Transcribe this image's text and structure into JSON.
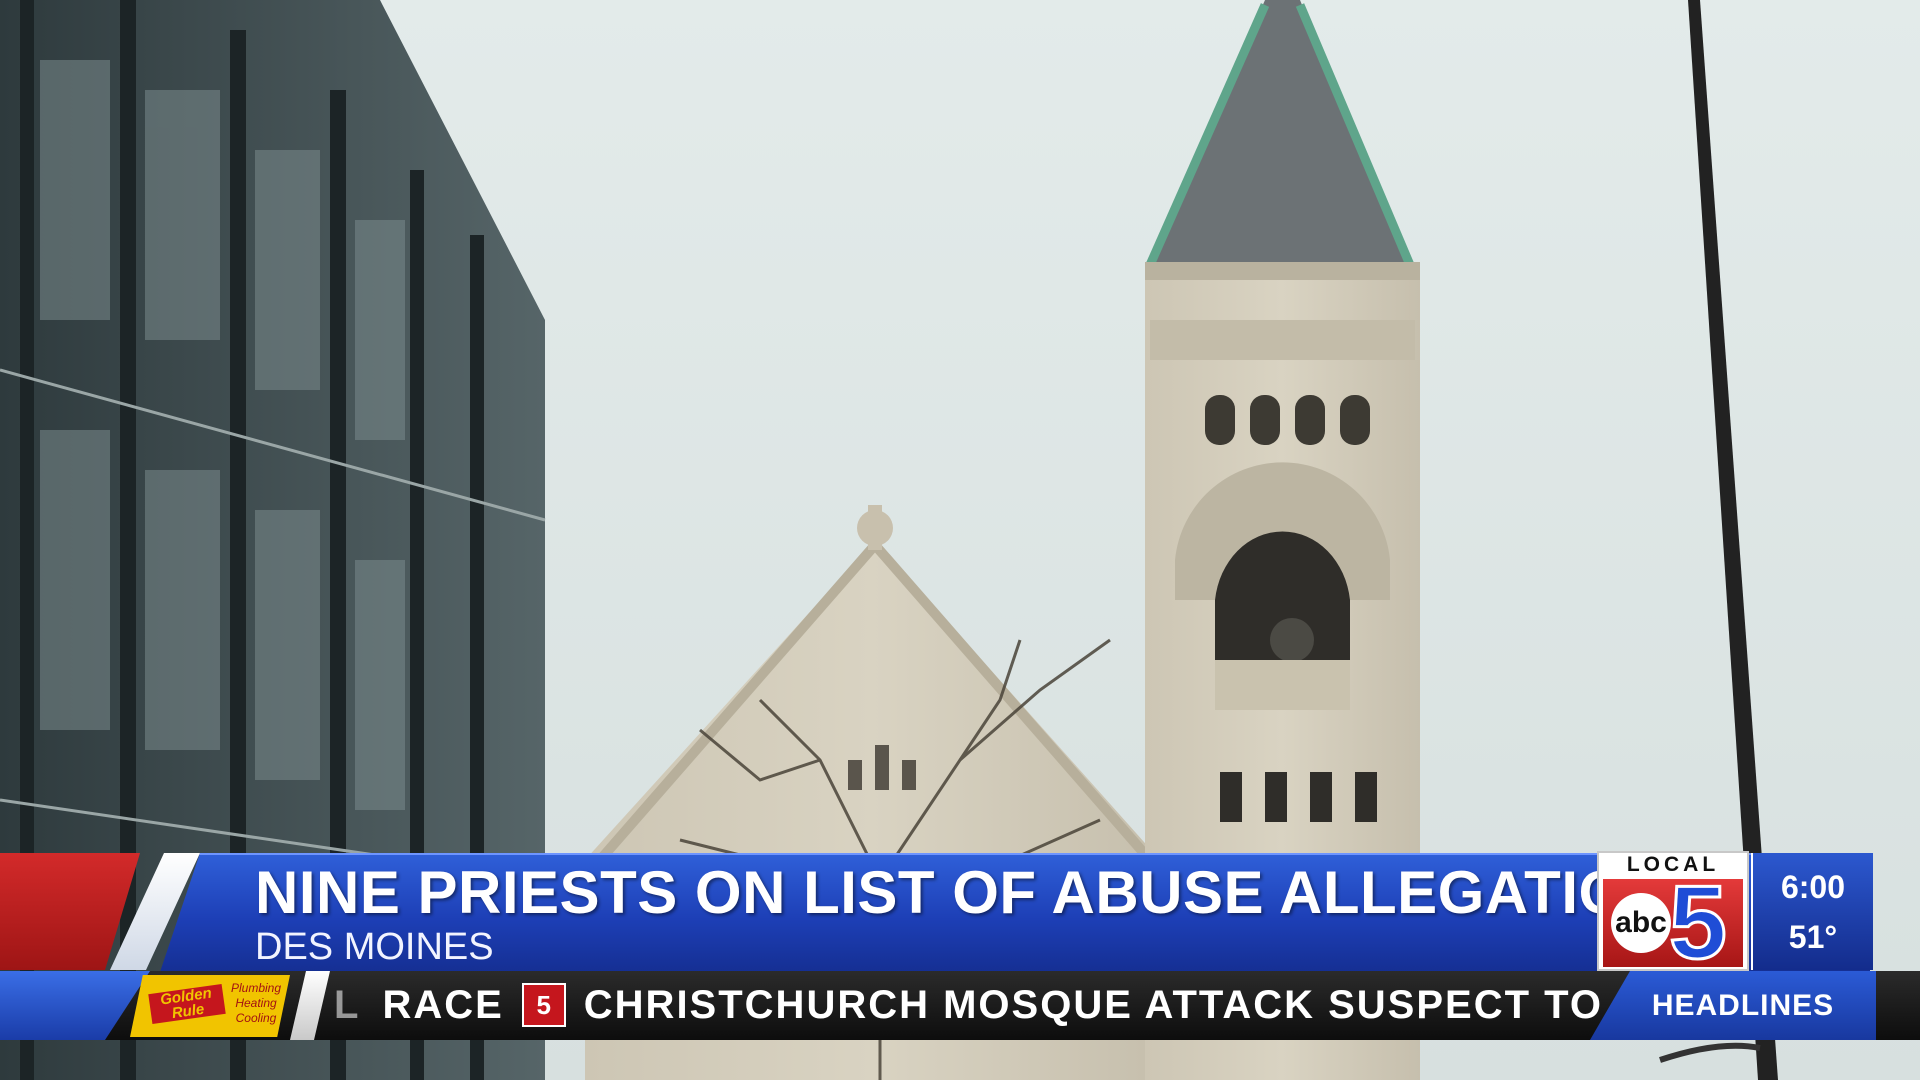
{
  "lower_third": {
    "headline": "NINE PRIESTS ON LIST OF ABUSE ALLEGATIONS",
    "location": "DES MOINES"
  },
  "station_logo": {
    "local": "LOCAL",
    "network": "abc",
    "channel": "5"
  },
  "clock": {
    "time": "6:00",
    "temperature": "51°"
  },
  "ticker": {
    "items": [
      "L",
      "RACE",
      "CHRISTCHURCH MOSQUE ATTACK SUSPECT TO"
    ],
    "bug_label": "5",
    "label": "HEADLINES"
  },
  "sponsor": {
    "brand": "Golden Rule",
    "services": [
      "Plumbing",
      "Heating",
      "Cooling"
    ]
  },
  "colors": {
    "sky": "#dfe7e6",
    "banner_blue": "#1d3fb6",
    "accent_red": "#c5161d",
    "ticker_bg": "#121212",
    "sponsor_yellow": "#f1c400"
  }
}
